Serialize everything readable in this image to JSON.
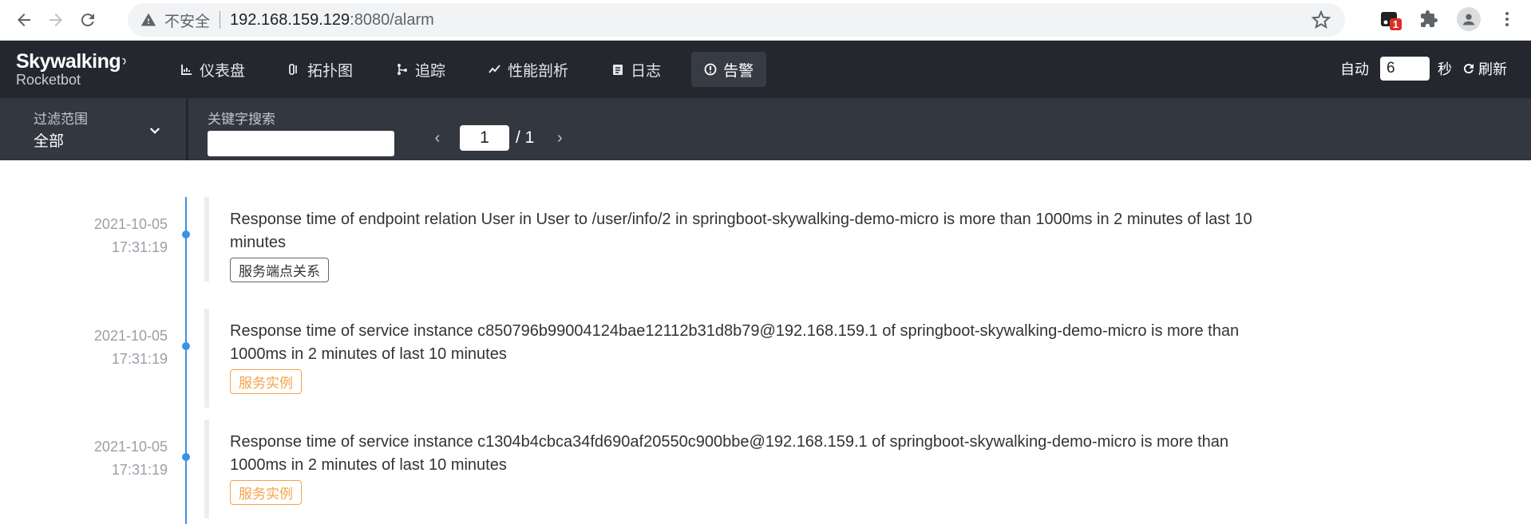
{
  "browser": {
    "insecure_label": "不安全",
    "url_host": "192.168.159.129",
    "url_rest": ":8080/alarm",
    "ext_badge": "1"
  },
  "header": {
    "brand": "Skywalking",
    "sub": "Rocketbot",
    "nav": [
      {
        "label": "仪表盘",
        "icon": "chart-icon"
      },
      {
        "label": "拓扑图",
        "icon": "topology-icon"
      },
      {
        "label": "追踪",
        "icon": "trace-icon"
      },
      {
        "label": "性能剖析",
        "icon": "profile-icon"
      },
      {
        "label": "日志",
        "icon": "log-icon"
      },
      {
        "label": "告警",
        "icon": "alarm-icon"
      }
    ],
    "auto_label": "自动",
    "interval_value": "6",
    "sec_label": "秒",
    "refresh_label": "刷新"
  },
  "filter": {
    "scope_label": "过滤范围",
    "scope_value": "全部",
    "keyword_label": "关键字搜索",
    "keyword_value": "",
    "page_current": "1",
    "page_total": "/ 1"
  },
  "alarms": [
    {
      "date": "2021-10-05",
      "time": "17:31:19",
      "message": "Response time of endpoint relation User in User to /user/info/2 in springboot-skywalking-demo-micro is more than 1000ms in 2 minutes of last 10 minutes",
      "tag": "服务端点关系"
    },
    {
      "date": "2021-10-05",
      "time": "17:31:19",
      "message": "Response time of service instance c850796b99004124bae12112b31d8b79@192.168.159.1 of springboot-skywalking-demo-micro is more than 1000ms in 2 minutes of last 10 minutes",
      "tag": "服务实例"
    },
    {
      "date": "2021-10-05",
      "time": "17:31:19",
      "message": "Response time of service instance c1304b4cbca34fd690af20550c900bbe@192.168.159.1 of springboot-skywalking-demo-micro is more than 1000ms in 2 minutes of last 10 minutes",
      "tag": "服务实例"
    }
  ],
  "colors": {
    "timeline_blue": "#3d92e6",
    "tag_orange": "#f3a34a",
    "header_bg": "#24272d"
  }
}
